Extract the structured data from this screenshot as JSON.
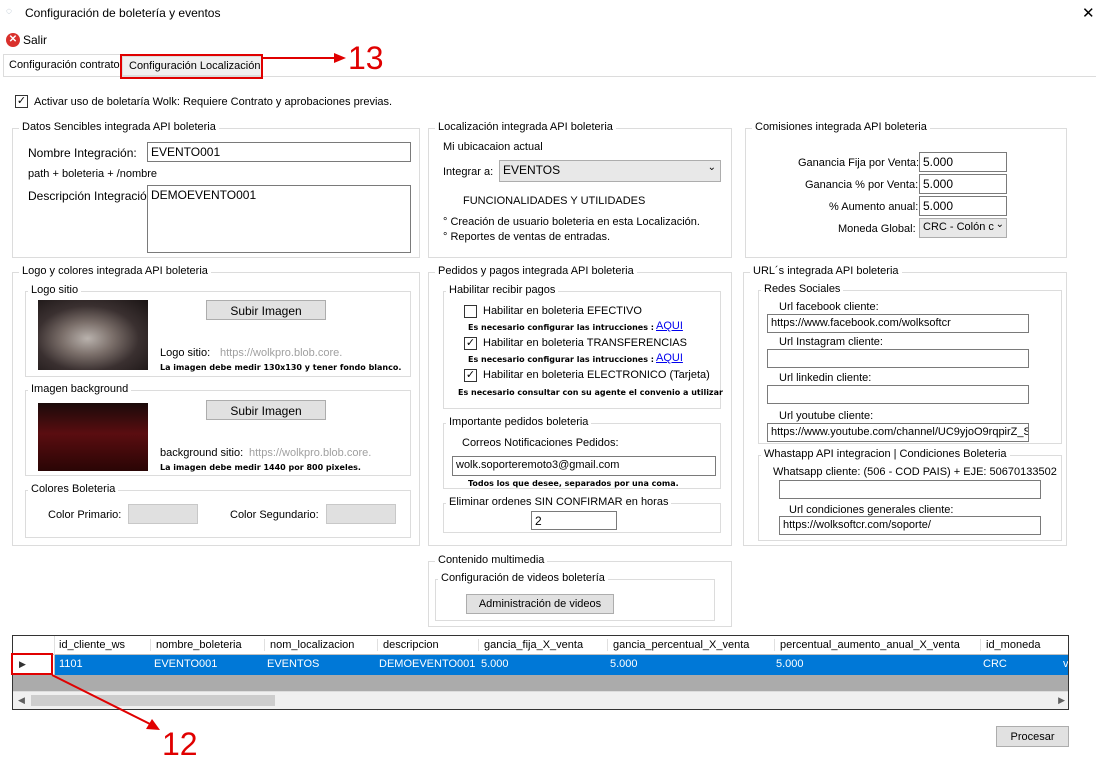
{
  "window": {
    "title": "Configuración de boletería y eventos",
    "close": "✕"
  },
  "toolbar": {
    "exit": "Salir"
  },
  "tabs": [
    "Configuración contrato",
    "Configuración Localización"
  ],
  "activate": "Activar uso de boletaría Wolk: Requiere Contrato y aprobaciones previas.",
  "sensitive": {
    "title": "Datos Sencibles integrada API boleteria",
    "name_label": "Nombre Integración:",
    "name_value": "EVENTO001",
    "path": "path + boleteria + /nombre",
    "desc_label": "Descripción Integración:",
    "desc_value": "DEMOEVENTO001"
  },
  "localization": {
    "title": "Localización integrada API boleteria",
    "mi": "Mi ubicacaion actual",
    "integrar": "Integrar a:",
    "integrar_value": "EVENTOS",
    "func_title": "FUNCIONALIDADES Y UTILIDADES",
    "f1": "° Creación de usuario boleteria en esta Localización.",
    "f2": "° Reportes de ventas de entradas."
  },
  "commissions": {
    "title": "Comisiones integrada API boleteria",
    "fija_label": "Ganancia Fija por Venta:",
    "fija": "5.000",
    "pct_label": "Ganancia % por Venta:",
    "pct": "5.000",
    "anual_label": "% Aumento anual:",
    "anual": "5.000",
    "moneda_label": "Moneda Global:",
    "moneda": "CRC - Colón c"
  },
  "logo": {
    "title": "Logo y colores integrada API boleteria",
    "sitio": "Logo sitio",
    "upload": "Subir Imagen",
    "logo_label": "Logo sitio:",
    "logo_url": "https://wolkpro.blob.core.",
    "logo_note": "La imagen debe medir 130x130 y tener fondo blanco.",
    "bg_title": "Imagen background",
    "bg_label": "background sitio:",
    "bg_url": "https://wolkpro.blob.core.",
    "bg_note": "La imagen debe medir 1440 por 800 pixeles.",
    "colors_title": "Colores Boleteria",
    "primary": "Color Primario:",
    "secondary": "Color Segundario:"
  },
  "payments": {
    "title": "Pedidos y pagos integrada API boleteria",
    "sub": "Habilitar recibir pagos",
    "c1": "Habilitar en boleteria EFECTIVO",
    "n1": "Es necesario configurar las intrucciones :",
    "aqui1": "AQUI",
    "c2": "Habilitar en boleteria TRANSFERENCIAS",
    "n2": "Es necesario configurar las intrucciones :",
    "aqui2": "AQUI",
    "c3": "Habilitar en boleteria ELECTRONICO (Tarjeta)",
    "n3": "Es necesario consultar con su agente el convenio a utilizar",
    "imp_title": "Importante pedidos boleteria",
    "correos": "Correos Notificaciones Pedidos:",
    "email": "wolk.soporteremoto3@gmail.com",
    "email_note": "Todos los que desee, separados por una coma.",
    "elim_title": "Eliminar ordenes SIN CONFIRMAR en horas",
    "elim": "2"
  },
  "urls": {
    "title": "URL´s  integrada API boleteria",
    "redes": "Redes Sociales",
    "fb_label": "Url facebook cliente:",
    "fb": "https://www.facebook.com/wolksoftcr",
    "ig_label": "Url Instagram cliente:",
    "ig": "",
    "li_label": "Url linkedin cliente:",
    "li": "",
    "yt_label": "Url youtube cliente:",
    "yt": "https://www.youtube.com/channel/UC9yjoO9rqpirZ_S",
    "wa_title": "Whastapp API integracion | Condiciones Boleteria",
    "wa_label": "Whatsapp cliente: (506 - COD PAIS) + EJE: 50670133502",
    "wa": "",
    "cond_label": "Url condiciones generales cliente:",
    "cond": "https://wolksoftcr.com/soporte/"
  },
  "multimedia": {
    "title": "Contenido multimedia",
    "sub": "Configuración de videos boletería",
    "btn": "Administración de videos"
  },
  "grid": {
    "headers": [
      "id_cliente_ws",
      "nombre_boleteria",
      "nom_localizacion",
      "descripcion",
      "gancia_fija_X_venta",
      "gancia_percentual_X_venta",
      "percentual_aumento_anual_X_venta",
      "id_moneda"
    ],
    "row": [
      "1101",
      "EVENTO001",
      "EVENTOS",
      "DEMOEVENTO001",
      "5.000",
      "5.000",
      "5.000",
      "CRC"
    ],
    "extra": "v"
  },
  "process": "Procesar",
  "annotations": {
    "a13": "13",
    "a12": "12"
  },
  "colors": {
    "accent": "#0078d7",
    "annotation": "#e00000"
  }
}
